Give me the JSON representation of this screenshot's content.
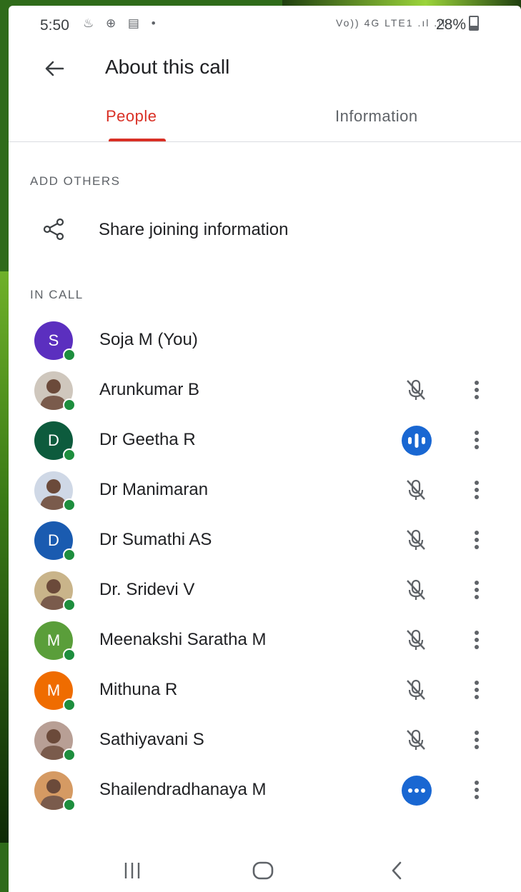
{
  "status_bar": {
    "time": "5:50",
    "left_icons": "♨ ⊕ ▤ •",
    "network_text": "Vo)) 4G LTE1 .ıl .ıl",
    "battery": "28%"
  },
  "header": {
    "title": "About this call"
  },
  "tabs": [
    {
      "label": "People",
      "active": true
    },
    {
      "label": "Information",
      "active": false
    }
  ],
  "add_others": {
    "section_label": "ADD OTHERS",
    "share_label": "Share joining information"
  },
  "in_call": {
    "section_label": "IN CALL",
    "participants": [
      {
        "name": "Soja M (You)",
        "initial": "S",
        "color": "#5b2fbf",
        "avatar": "letter",
        "audio": "none"
      },
      {
        "name": "Arunkumar B",
        "initial": "",
        "color": "#cfc7bd",
        "avatar": "photo",
        "audio": "muted"
      },
      {
        "name": "Dr Geetha R",
        "initial": "D",
        "color": "#0d5b3d",
        "avatar": "letter",
        "audio": "speaking"
      },
      {
        "name": "Dr Manimaran",
        "initial": "",
        "color": "#cfd8e6",
        "avatar": "photo",
        "audio": "muted"
      },
      {
        "name": "Dr Sumathi AS",
        "initial": "D",
        "color": "#1a5bb0",
        "avatar": "letter",
        "audio": "muted"
      },
      {
        "name": "Dr. Sridevi V",
        "initial": "",
        "color": "#c9b48a",
        "avatar": "photo",
        "audio": "muted"
      },
      {
        "name": "Meenakshi Saratha M",
        "initial": "M",
        "color": "#5a9e3a",
        "avatar": "letter",
        "audio": "muted"
      },
      {
        "name": "Mithuna R",
        "initial": "M",
        "color": "#ef6c00",
        "avatar": "letter",
        "audio": "muted"
      },
      {
        "name": "Sathiyavani S",
        "initial": "",
        "color": "#b89f95",
        "avatar": "photo",
        "audio": "muted"
      },
      {
        "name": "Shailendradhanaya M",
        "initial": "",
        "color": "#d59a63",
        "avatar": "photo",
        "audio": "unmuted-idle"
      }
    ]
  },
  "colors": {
    "accent_red": "#d93025",
    "speaking_blue": "#1967d2",
    "online_green": "#1e8e3e"
  },
  "icons": {
    "back": "arrow-left-icon",
    "share": "share-icon",
    "muted": "mic-off-icon",
    "more": "more-vert-icon"
  }
}
